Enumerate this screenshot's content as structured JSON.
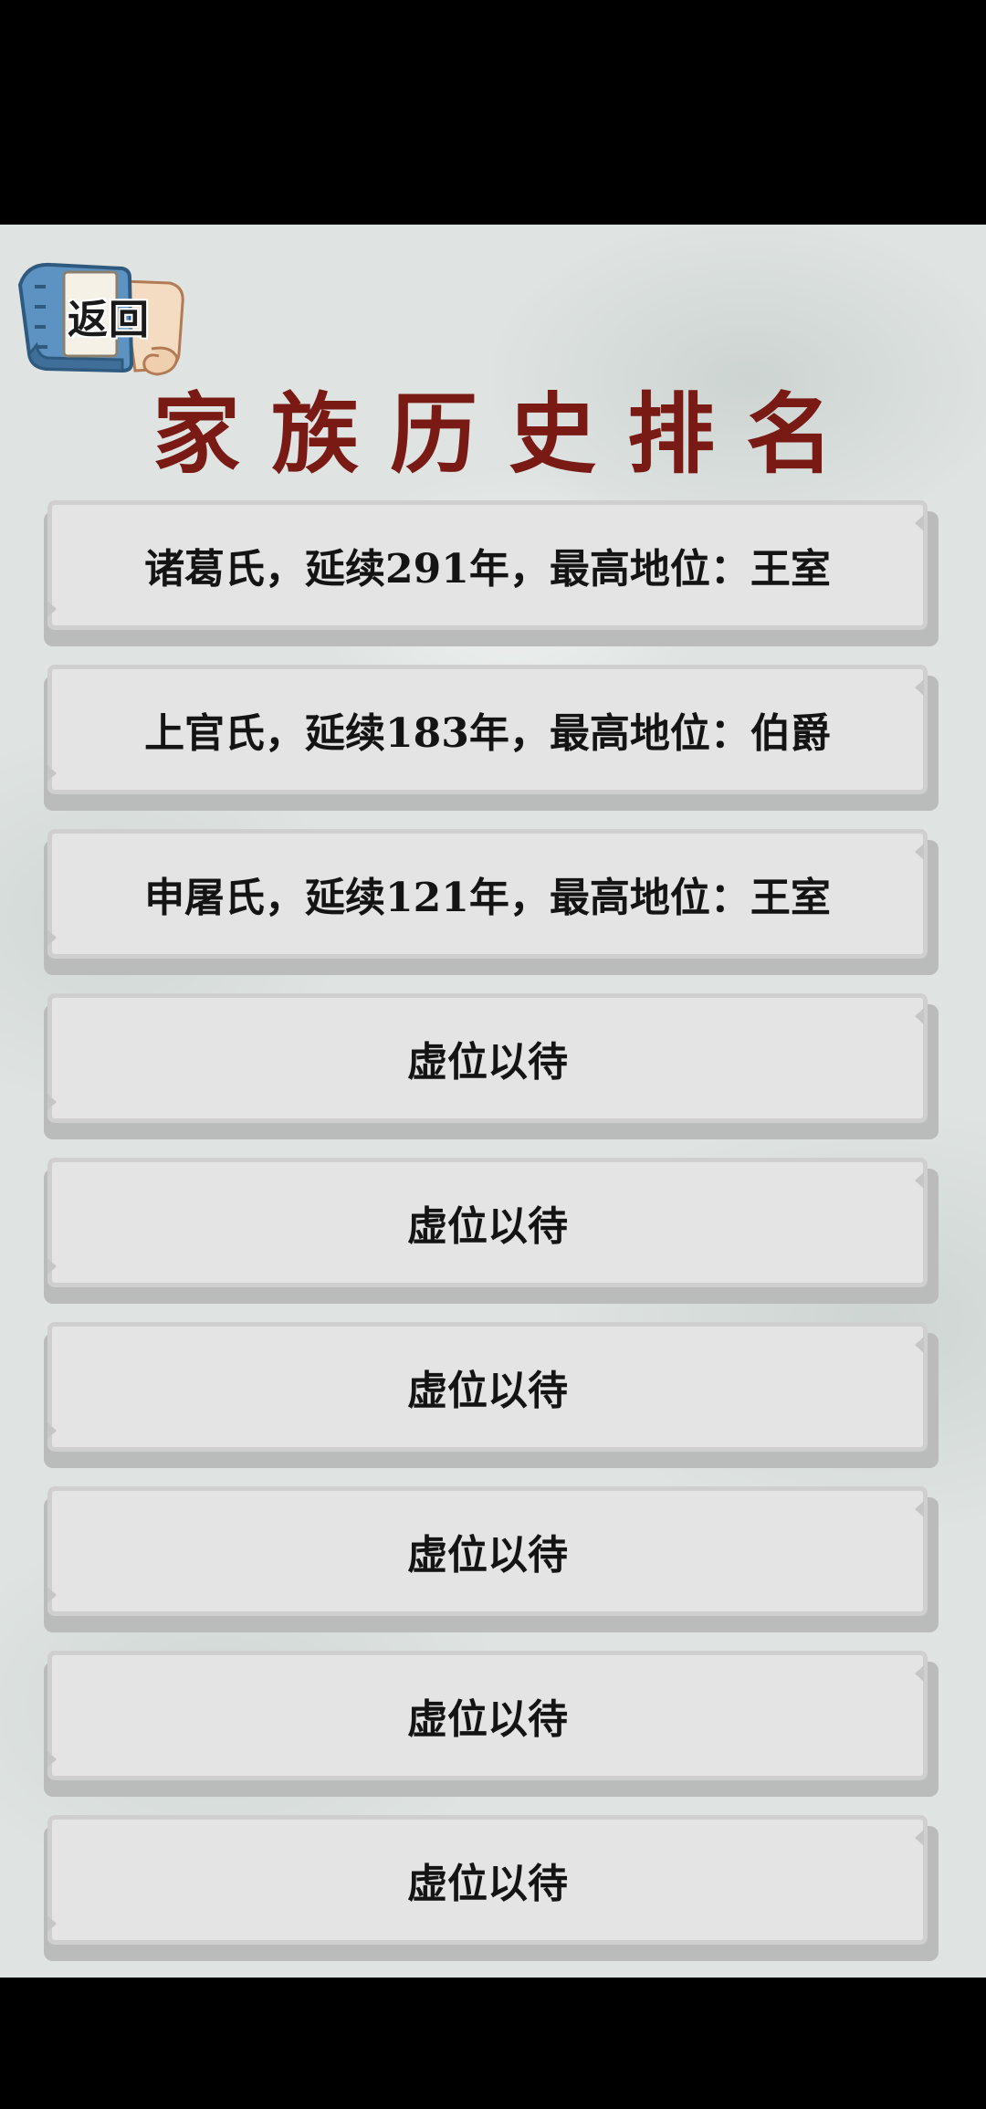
{
  "header": {
    "back_label": "返回",
    "title": "家族历史排名"
  },
  "rankings": [
    {
      "text": "诸葛氏，延续291年，最高地位：王室"
    },
    {
      "text": "上官氏，延续183年，最高地位：伯爵"
    },
    {
      "text": "申屠氏，延续121年，最高地位：王室"
    },
    {
      "text": "虚位以待"
    },
    {
      "text": "虚位以待"
    },
    {
      "text": "虚位以待"
    },
    {
      "text": "虚位以待"
    },
    {
      "text": "虚位以待"
    },
    {
      "text": "虚位以待"
    }
  ],
  "colors": {
    "title": "#7a1a14",
    "panel": "#e4e4e4",
    "background": "#dfe4e2"
  }
}
